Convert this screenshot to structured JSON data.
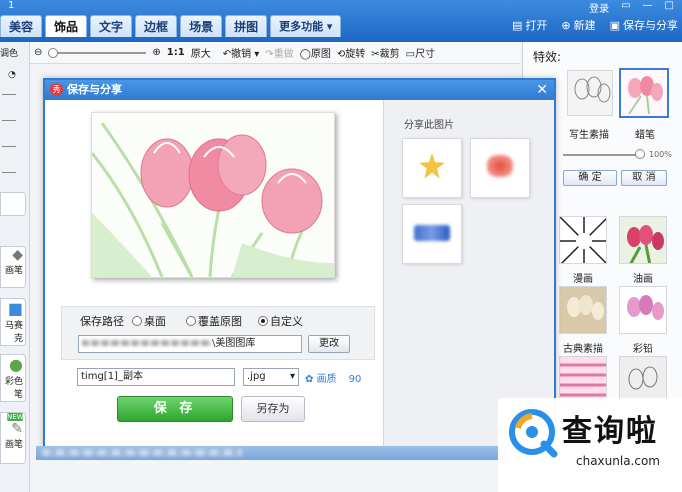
{
  "app": {
    "corner_title": "1",
    "minis": [
      "登录",
      "▭",
      "—",
      "□"
    ]
  },
  "tabs": [
    {
      "label": "美容"
    },
    {
      "label": "饰品"
    },
    {
      "label": "文字"
    },
    {
      "label": "边框"
    },
    {
      "label": "场景"
    },
    {
      "label": "拼图"
    },
    {
      "label": "更多功能 ▾"
    }
  ],
  "actions": {
    "open": "打开",
    "new": "新建",
    "save_share": "保存与分享"
  },
  "toolbar": {
    "ratio": "1:1",
    "original_size": "原大",
    "undo": "撤销",
    "redo": "重做",
    "original": "原图",
    "rotate": "旋转",
    "crop": "裁剪",
    "size": "尺寸",
    "zoom_level_fraction": 0.0
  },
  "leftcol": {
    "top_label": "调色",
    "items": [
      "画笔",
      "马赛克",
      "彩色笔",
      "画笔"
    ],
    "badge": "NEW"
  },
  "rightpanel": {
    "title": "特效:",
    "row1": [
      {
        "label": "写生素描"
      },
      {
        "label": "蜡笔"
      }
    ],
    "intensity": "100%",
    "intensity_fraction": 1.0,
    "confirm": "确 定",
    "cancel": "取 消",
    "row2": [
      {
        "label": "漫画"
      },
      {
        "label": "油画"
      }
    ],
    "row3": [
      {
        "label": "古典素描"
      },
      {
        "label": "彩铅"
      }
    ]
  },
  "dialog": {
    "title": "保存与分享",
    "close": "✕",
    "share_label": "分享此图片",
    "path_label": "保存路径",
    "radio_desktop": "桌面",
    "radio_overwrite": "覆盖原图",
    "radio_custom": "自定义",
    "path_value": "\\美图图库",
    "change_button": "更改",
    "filename": "timg[1]_副本",
    "format": ".jpg",
    "quality_label": "画质",
    "quality_value": "90",
    "save": "保 存",
    "save_as": "另存为"
  },
  "watermark": {
    "title": "查询啦",
    "url": "chaxunla.com"
  },
  "colors": {
    "accent": "#2f7bd2",
    "save_green": "#2ea52e",
    "tulip_pink": "#f07d99"
  }
}
